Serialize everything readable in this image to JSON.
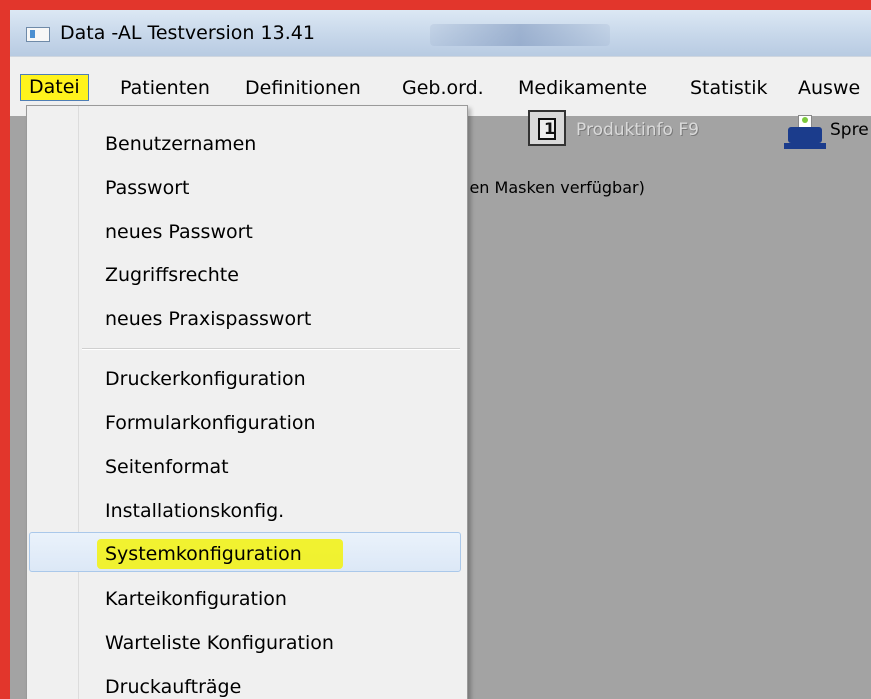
{
  "window": {
    "title": "Data -AL Testversion 13.41"
  },
  "menubar": {
    "items": [
      {
        "label": "Datei"
      },
      {
        "label": "Patienten"
      },
      {
        "label": "Definitionen"
      },
      {
        "label": "Geb.ord."
      },
      {
        "label": "Medikamente"
      },
      {
        "label": "Statistik"
      },
      {
        "label": "Auswe"
      }
    ]
  },
  "toolbar": {
    "produktinfo_label": "Produktinfo F9",
    "printer_label": "Spre"
  },
  "workarea": {
    "hint": "len Masken verfügbar)"
  },
  "datei_menu": {
    "items": [
      {
        "label": "Benutzernamen"
      },
      {
        "label": "Passwort"
      },
      {
        "label": "neues Passwort"
      },
      {
        "label": "Zugriffsrechte"
      },
      {
        "label": "neues Praxispasswort"
      },
      {
        "label": "Druckerkonfiguration"
      },
      {
        "label": "Formularkonfiguration"
      },
      {
        "label": "Seitenformat"
      },
      {
        "label": "Installationskonfig."
      },
      {
        "label": "Systemkonfiguration"
      },
      {
        "label": "Karteikonfiguration"
      },
      {
        "label": "Warteliste Konfiguration"
      },
      {
        "label": "Druckaufträge"
      }
    ],
    "highlighted_item": "Systemkonfiguration"
  }
}
